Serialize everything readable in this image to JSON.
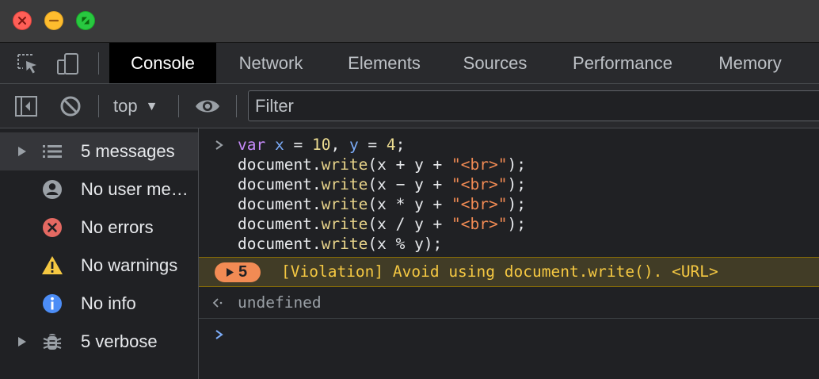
{
  "window": {
    "traffic_lights": [
      "close",
      "minimize",
      "maximize"
    ]
  },
  "tabs": [
    {
      "label": "Console",
      "active": true
    },
    {
      "label": "Network",
      "active": false
    },
    {
      "label": "Elements",
      "active": false
    },
    {
      "label": "Sources",
      "active": false
    },
    {
      "label": "Performance",
      "active": false
    },
    {
      "label": "Memory",
      "active": false
    }
  ],
  "toolbar": {
    "context": "top",
    "filter_placeholder": "Filter"
  },
  "sidebar": {
    "items": [
      {
        "label": "5 messages",
        "icon": "list-icon",
        "expandable": true,
        "selected": true
      },
      {
        "label": "No user me…",
        "icon": "user-icon",
        "expandable": false,
        "selected": false
      },
      {
        "label": "No errors",
        "icon": "error-icon",
        "expandable": false,
        "selected": false
      },
      {
        "label": "No warnings",
        "icon": "warning-icon",
        "expandable": false,
        "selected": false
      },
      {
        "label": "No info",
        "icon": "info-icon",
        "expandable": false,
        "selected": false
      },
      {
        "label": "5 verbose",
        "icon": "bug-icon",
        "expandable": true,
        "selected": false
      }
    ]
  },
  "console": {
    "code_lines": [
      [
        [
          "kw",
          "var"
        ],
        [
          "op",
          " "
        ],
        [
          "vr",
          "x"
        ],
        [
          "op",
          " = "
        ],
        [
          "nm",
          "10"
        ],
        [
          "op",
          ", "
        ],
        [
          "vr",
          "y"
        ],
        [
          "op",
          " = "
        ],
        [
          "nm",
          "4"
        ],
        [
          "op",
          ";"
        ]
      ],
      [
        [
          "op",
          "document."
        ],
        [
          "fn",
          "write"
        ],
        [
          "op",
          "(x + y + "
        ],
        [
          "st",
          "\"<br>\""
        ],
        [
          "op",
          ");"
        ]
      ],
      [
        [
          "op",
          "document."
        ],
        [
          "fn",
          "write"
        ],
        [
          "op",
          "(x − y + "
        ],
        [
          "st",
          "\"<br>\""
        ],
        [
          "op",
          ");"
        ]
      ],
      [
        [
          "op",
          "document."
        ],
        [
          "fn",
          "write"
        ],
        [
          "op",
          "(x * y + "
        ],
        [
          "st",
          "\"<br>\""
        ],
        [
          "op",
          ");"
        ]
      ],
      [
        [
          "op",
          "document."
        ],
        [
          "fn",
          "write"
        ],
        [
          "op",
          "(x / y + "
        ],
        [
          "st",
          "\"<br>\""
        ],
        [
          "op",
          ");"
        ]
      ],
      [
        [
          "op",
          "document."
        ],
        [
          "fn",
          "write"
        ],
        [
          "op",
          "(x % y);"
        ]
      ]
    ],
    "warning": {
      "count": "5",
      "text": "[Violation] Avoid using document.write(). <URL>"
    },
    "result": "undefined"
  },
  "colors": {
    "accent": "#7cacf8",
    "warning_text": "#f5c842",
    "warning_bg": "#413c26",
    "badge": "#f28b54",
    "error": "#e46962",
    "info": "#4c8df6"
  }
}
